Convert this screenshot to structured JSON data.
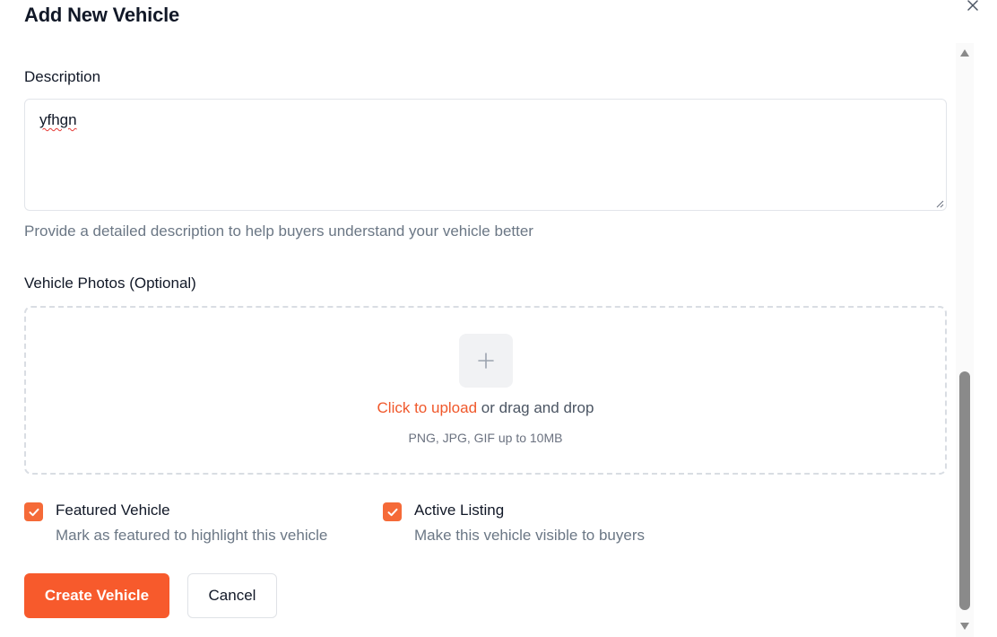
{
  "dialog": {
    "title": "Add New Vehicle"
  },
  "description": {
    "label": "Description",
    "value": "yfhgn",
    "helper": "Provide a detailed description to help buyers understand your vehicle better"
  },
  "photos": {
    "label": "Vehicle Photos (Optional)",
    "upload_link": "Click to upload",
    "upload_rest": " or drag and drop",
    "hint": "PNG, JPG, GIF up to 10MB"
  },
  "options": {
    "featured": {
      "label": "Featured Vehicle",
      "description": "Mark as featured to highlight this vehicle",
      "checked": true
    },
    "active": {
      "label": "Active Listing",
      "description": "Make this vehicle visible to buyers",
      "checked": true
    }
  },
  "actions": {
    "create_label": "Create Vehicle",
    "cancel_label": "Cancel"
  },
  "colors": {
    "accent": "#f75a2c",
    "checkbox": "#f56a38",
    "muted_text": "#6b7785"
  },
  "icons": {
    "close": "close-icon",
    "upload": "plus-icon",
    "check": "checkmark-icon",
    "scroll_up": "scroll-up-arrow-icon",
    "scroll_down": "scroll-down-arrow-icon"
  }
}
